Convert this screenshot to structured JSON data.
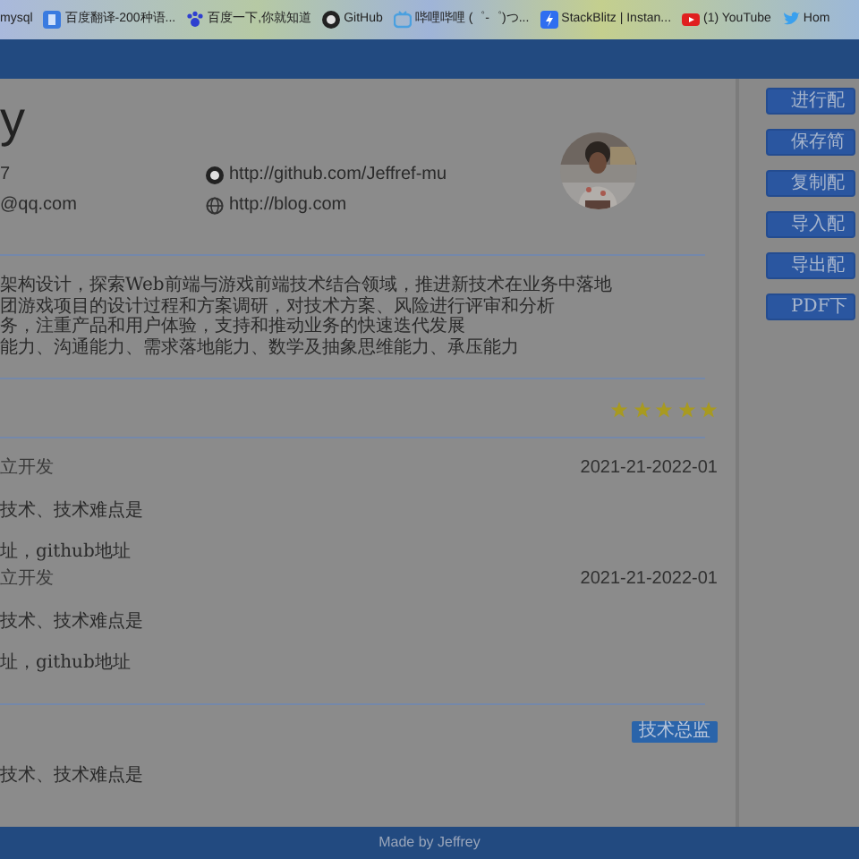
{
  "bookmarks": [
    {
      "label": "mysql",
      "kind": "none"
    },
    {
      "label": "百度翻译-200种语...",
      "kind": "translate"
    },
    {
      "label": "百度一下,你就知道",
      "kind": "paw"
    },
    {
      "label": "GitHub",
      "kind": "github"
    },
    {
      "label": "哔哩哔哩 (゜-゜)つ...",
      "kind": "tv"
    },
    {
      "label": "StackBlitz | Instan...",
      "kind": "bolt"
    },
    {
      "label": "(1) YouTube",
      "kind": "play"
    },
    {
      "label": "Hom",
      "kind": "bird"
    }
  ],
  "resume": {
    "name": "y",
    "contacts": [
      {
        "text": "7",
        "kind": "plain"
      },
      {
        "text": "http://github.com/Jeffref-mu",
        "kind": "github"
      },
      {
        "text": "@qq.com",
        "kind": "plain"
      },
      {
        "text": "http://blog.com",
        "kind": "web"
      }
    ],
    "summary": [
      "架构设计，探索Web前端与游戏前端技术结合领域，推进新技术在业务中落地",
      "团游戏项目的设计过程和方案调研，对技术方案、风险进行评审和分析",
      "务，注重产品和用户体验，支持和推动业务的快速迭代发展",
      "能力、沟通能力、需求落地能力、数学及抽象思维能力、承压能力"
    ],
    "rating": {
      "stars": 5
    },
    "projects": [
      {
        "title": "立开发",
        "date": "2021-21-2022-01",
        "lines": [
          "技术、技术难点是",
          "址，github地址"
        ]
      },
      {
        "title": "立开发",
        "date": "2021-21-2022-01",
        "lines": [
          "技术、技术难点是",
          "址，github地址"
        ]
      }
    ],
    "job": {
      "badge": "技术总监",
      "lines": [
        "技术、技术难点是"
      ]
    }
  },
  "sidebar": {
    "buttons": [
      "进行配",
      "保存简",
      "复制配",
      "导入配",
      "导出配",
      "PDF下"
    ]
  },
  "footer": "Made by Jeffrey"
}
